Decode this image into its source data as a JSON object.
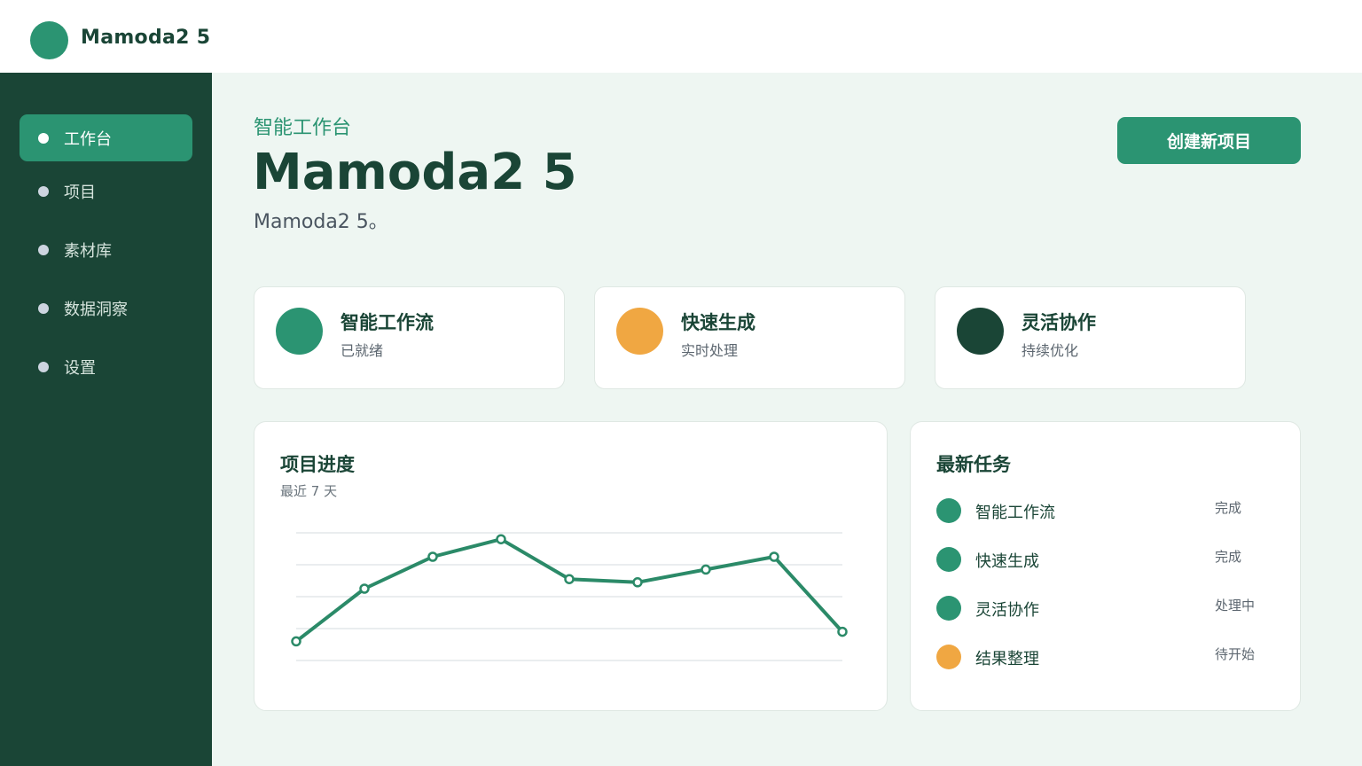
{
  "app": {
    "name": "Mamoda2 5"
  },
  "sidebar": {
    "items": [
      {
        "label": "工作台",
        "active": true
      },
      {
        "label": "项目",
        "active": false
      },
      {
        "label": "素材库",
        "active": false
      },
      {
        "label": "数据洞察",
        "active": false
      },
      {
        "label": "设置",
        "active": false
      }
    ]
  },
  "header": {
    "eyebrow": "智能工作台",
    "title": "Mamoda2 5",
    "subtitle": "Mamoda2 5。",
    "create_button": "创建新项目"
  },
  "stats": [
    {
      "title": "智能工作流",
      "subtitle": "已就绪",
      "color": "#2b9472"
    },
    {
      "title": "快速生成",
      "subtitle": "实时处理",
      "color": "#f0a742"
    },
    {
      "title": "灵活协作",
      "subtitle": "持续优化",
      "color": "#1a4536"
    }
  ],
  "progress": {
    "title": "项目进度",
    "subtitle": "最近 7 天"
  },
  "chart_data": {
    "type": "line",
    "title": "项目进度",
    "subtitle": "最近 7 天",
    "ylim": [
      0,
      4
    ],
    "grid": true,
    "series": [
      {
        "values": [
          0.6,
          2.25,
          3.25,
          3.8,
          2.55,
          2.45,
          2.85,
          3.25,
          0.9
        ]
      }
    ],
    "color": "#2b8a68"
  },
  "tasks": {
    "title": "最新任务",
    "items": [
      {
        "name": "智能工作流",
        "status": "完成",
        "color": "#2b9472"
      },
      {
        "name": "快速生成",
        "status": "完成",
        "color": "#2b9472"
      },
      {
        "name": "灵活协作",
        "status": "处理中",
        "color": "#2b9472"
      },
      {
        "name": "结果整理",
        "status": "待开始",
        "color": "#f0a742"
      }
    ]
  }
}
